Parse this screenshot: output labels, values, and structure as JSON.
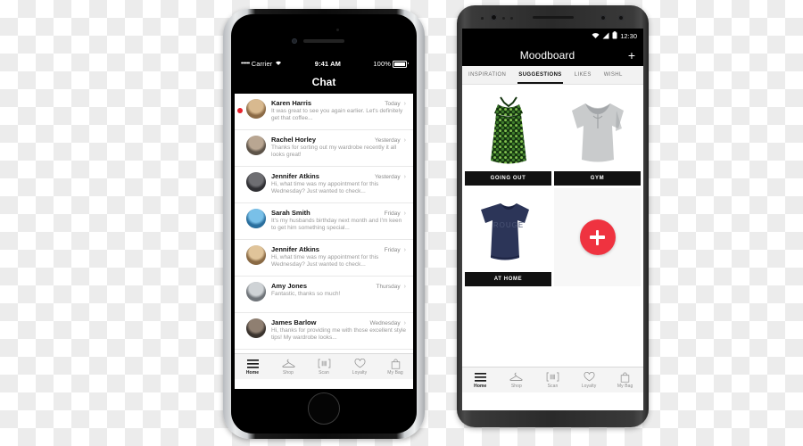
{
  "scene": {
    "background": "transparency-checkerboard",
    "checker_colors": [
      "#ffffff",
      "#ececec"
    ]
  },
  "iphone": {
    "status_bar": {
      "signal_dots": "•••••",
      "carrier": "Carrier",
      "wifi_icon": "wifi-icon",
      "time": "9:41 AM",
      "battery_percent": "100%",
      "battery_icon": "battery-full-icon"
    },
    "nav": {
      "title": "Chat"
    },
    "chats": [
      {
        "name": "Karen Harris",
        "time": "Today",
        "preview": "It was great to see you again earlier. Let's definitely get that coffee...",
        "unread": true,
        "avatar_colors": [
          "#d8b98f",
          "#8c6b46"
        ]
      },
      {
        "name": "Rachel Horley",
        "time": "Yesterday",
        "preview": "Thanks for sorting out my wardrobe recently it all looks great!",
        "unread": false,
        "avatar_colors": [
          "#b9a692",
          "#5d5348"
        ]
      },
      {
        "name": "Jennifer Atkins",
        "time": "Yesterday",
        "preview": "Hi, what time was my appointment for this Wednesday? Just wanted to check...",
        "unread": false,
        "avatar_colors": [
          "#6e6e72",
          "#2f2f33"
        ]
      },
      {
        "name": "Sarah Smith",
        "time": "Friday",
        "preview": "It's my husbands birthday next month and I'm keen to get him something special...",
        "unread": false,
        "avatar_colors": [
          "#79c0e8",
          "#2a6f9e"
        ]
      },
      {
        "name": "Jennifer Atkins",
        "time": "Friday",
        "preview": "Hi, what time was my appointment for this Wednesday? Just wanted to check...",
        "unread": false,
        "avatar_colors": [
          "#e0c49a",
          "#8a6a44"
        ]
      },
      {
        "name": "Amy Jones",
        "time": "Thursday",
        "preview": "Fantastic, thanks so much!",
        "unread": false,
        "avatar_colors": [
          "#cfd3d6",
          "#6f7479"
        ]
      },
      {
        "name": "James Barlow",
        "time": "Wednesday",
        "preview": "Hi, thanks for providing me with those excellent style tips! My wardrobe looks...",
        "unread": false,
        "avatar_colors": [
          "#8f7f71",
          "#3a332d"
        ]
      }
    ],
    "chevron": "›",
    "tabbar": [
      {
        "label": "Home",
        "icon": "hamburger-menu-icon",
        "active": true
      },
      {
        "label": "Shop",
        "icon": "clothes-hanger-icon",
        "active": false
      },
      {
        "label": "Scan",
        "icon": "barcode-scan-icon",
        "active": false
      },
      {
        "label": "Loyalty",
        "icon": "heart-icon",
        "active": false
      },
      {
        "label": "My Bag",
        "icon": "shopping-bag-icon",
        "active": false
      }
    ]
  },
  "android": {
    "status_bar": {
      "wifi_icon": "wifi-icon",
      "signal_icon": "cell-signal-icon",
      "battery_icon": "battery-icon",
      "time": "12:30"
    },
    "nav": {
      "title": "Moodboard",
      "add_label": "+"
    },
    "tabs": [
      {
        "label": "INSPIRATION",
        "active": false
      },
      {
        "label": "SUGGESTIONS",
        "active": true
      },
      {
        "label": "LIKES",
        "active": false
      },
      {
        "label": "WISHL",
        "active": false
      }
    ],
    "cards": [
      {
        "caption": "GOING OUT",
        "item": "green-floral-dress",
        "colors": [
          "#3f7d2c",
          "#7fc04f",
          "#14340f"
        ]
      },
      {
        "caption": "GYM",
        "item": "grey-hoodie",
        "colors": [
          "#c9cbcc",
          "#9ea1a3",
          "#e4e6e7"
        ]
      },
      {
        "caption": "AT HOME",
        "item": "navy-rouge-tshirt",
        "colors": [
          "#2c3558",
          "#1b2240",
          "#4b5576"
        ],
        "print": "ROUGE"
      }
    ],
    "add_button": {
      "icon": "plus-circle-icon",
      "color": "#ef3340"
    },
    "tabbar": [
      {
        "label": "Home",
        "icon": "hamburger-menu-icon",
        "active": true
      },
      {
        "label": "Shop",
        "icon": "clothes-hanger-icon",
        "active": false
      },
      {
        "label": "Scan",
        "icon": "barcode-scan-icon",
        "active": false
      },
      {
        "label": "Loyalty",
        "icon": "heart-icon",
        "active": false
      },
      {
        "label": "My Bag",
        "icon": "shopping-bag-icon",
        "active": false
      }
    ]
  }
}
